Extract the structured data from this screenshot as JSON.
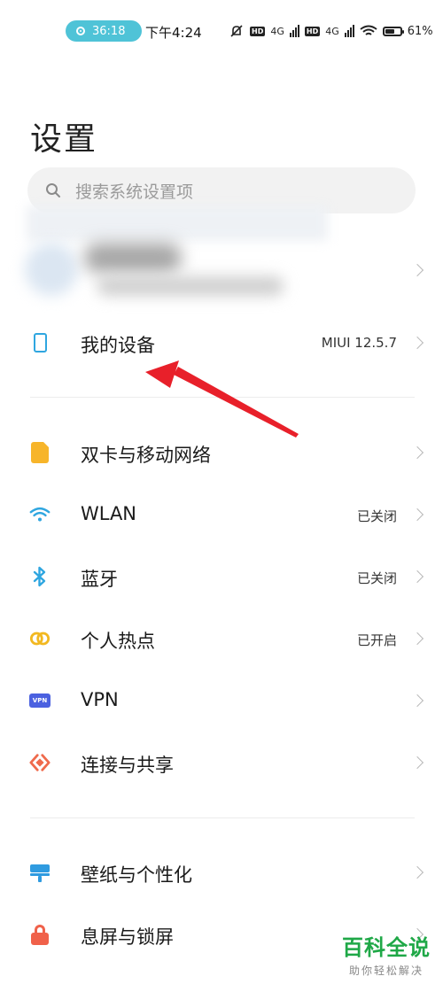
{
  "status_bar": {
    "record_timer": "36:18",
    "time": "下午4:24",
    "hd_label": "HD",
    "network_label": "4G",
    "battery_percent": "61%",
    "battery_level": 0.61
  },
  "header": {
    "title": "设置"
  },
  "search": {
    "placeholder": "搜索系统设置项"
  },
  "section1": [
    {
      "label": "我的设备",
      "value": "MIUI 12.5.7",
      "icon": "phone-icon"
    }
  ],
  "section2": [
    {
      "label": "双卡与移动网络",
      "value": "",
      "icon": "sim-card-icon"
    },
    {
      "label": "WLAN",
      "value": "已关闭",
      "icon": "wifi-icon"
    },
    {
      "label": "蓝牙",
      "value": "已关闭",
      "icon": "bluetooth-icon"
    },
    {
      "label": "个人热点",
      "value": "已开启",
      "icon": "hotspot-icon"
    },
    {
      "label": "VPN",
      "value": "",
      "icon": "vpn-icon",
      "icon_text": "VPN"
    },
    {
      "label": "连接与共享",
      "value": "",
      "icon": "connection-share-icon"
    }
  ],
  "section3": [
    {
      "label": "壁纸与个性化",
      "value": "",
      "icon": "wallpaper-icon"
    },
    {
      "label": "息屏与锁屏",
      "value": "",
      "icon": "lock-icon"
    }
  ],
  "watermark": {
    "title": "百科全说",
    "subtitle": "助你轻松解决"
  },
  "colors": {
    "accent_blue": "#2fa6e0",
    "arrow_red": "#e8202a",
    "watermark_green": "#1fa847"
  }
}
